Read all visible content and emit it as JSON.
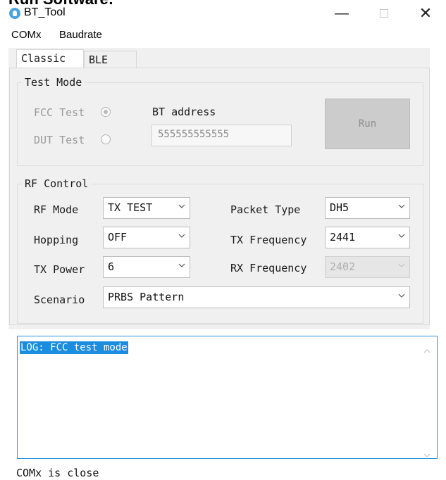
{
  "top_heading": "Run Software:",
  "window": {
    "title": "BT_Tool",
    "minimize_glyph": "—",
    "close_glyph": "✕",
    "icon": "bluetooth-app-icon"
  },
  "menu": {
    "comx": "COMx",
    "baudrate": "Baudrate"
  },
  "tabs": [
    {
      "label": "Classic",
      "active": true
    },
    {
      "label": "BLE",
      "active": false
    }
  ],
  "test_mode": {
    "group_label": "Test Mode",
    "fcc_label": "FCC Test",
    "fcc_checked": true,
    "dut_label": "DUT Test",
    "dut_checked": false,
    "bt_address_label": "BT address",
    "bt_address_value": "555555555555",
    "run_label": "Run"
  },
  "rf_control": {
    "group_label": "RF Control",
    "rf_mode_label": "RF Mode",
    "rf_mode_value": "TX TEST",
    "hopping_label": "Hopping",
    "hopping_value": "OFF",
    "tx_power_label": "TX Power",
    "tx_power_value": "6",
    "packet_type_label": "Packet Type",
    "packet_type_value": "DH5",
    "tx_freq_label": "TX Frequency",
    "tx_freq_value": "2441",
    "rx_freq_label": "RX Frequency",
    "rx_freq_value": "2402",
    "scenario_label": "Scenario",
    "scenario_value": "PRBS Pattern"
  },
  "log": {
    "line": "LOG: FCC test mode"
  },
  "status": "COMx is close",
  "colors": {
    "accent": "#1a8ddf",
    "panel_bg": "#f0f0f0",
    "app_icon": "#4aa3df"
  }
}
